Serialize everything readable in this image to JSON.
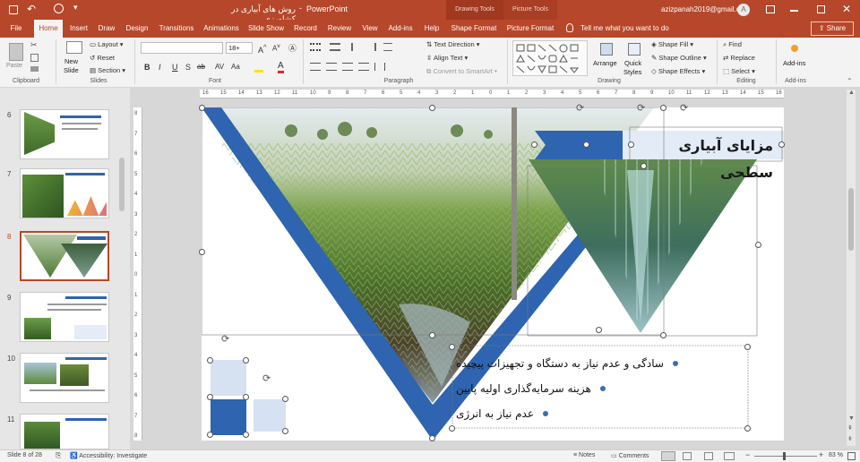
{
  "window": {
    "doc_title": "روش های آبیاری در کشاورزی",
    "app_name": "PowerPoint",
    "context_drawing": "Drawing Tools",
    "context_picture": "Picture Tools",
    "user_email": "azizpanah2019@gmail.com",
    "avatar_initial": "A"
  },
  "tabs": [
    "File",
    "Home",
    "Insert",
    "Draw",
    "Design",
    "Transitions",
    "Animations",
    "Slide Show",
    "Record",
    "Review",
    "View",
    "Add-ins",
    "Help",
    "Shape Format",
    "Picture Format"
  ],
  "tell_me": "Tell me what you want to do",
  "share_label": "Share",
  "ribbon": {
    "clipboard": {
      "paste": "Paste",
      "label": "Clipboard"
    },
    "slides": {
      "new_slide": "New",
      "new_slide2": "Slide",
      "layout": "Layout",
      "reset": "Reset",
      "section": "Section",
      "label": "Slides"
    },
    "font": {
      "size": "18+",
      "label": "Font",
      "bold": "B",
      "italic": "I",
      "underline": "U",
      "strike": "S",
      "shadow": "ab",
      "spacing": "AV",
      "case": "Aa",
      "color_a": "A"
    },
    "paragraph": {
      "text_direction": "Text Direction",
      "align_text": "Align Text",
      "smartart": "Convert to SmartArt",
      "label": "Paragraph"
    },
    "drawing": {
      "arrange": "Arrange",
      "quick": "Quick",
      "styles": "Styles",
      "shape_fill": "Shape Fill",
      "shape_outline": "Shape Outline",
      "shape_effects": "Shape Effects",
      "label": "Drawing"
    },
    "editing": {
      "find": "Find",
      "replace": "Replace",
      "select": "Select",
      "label": "Editing"
    },
    "addins": {
      "addins": "Add-ins",
      "label": "Add-ins"
    }
  },
  "ruler": {
    "h_ticks": [
      "16",
      "15",
      "14",
      "13",
      "12",
      "11",
      "10",
      "9",
      "8",
      "7",
      "6",
      "5",
      "4",
      "3",
      "2",
      "1",
      "0",
      "1",
      "2",
      "3",
      "4",
      "5",
      "6",
      "7",
      "8",
      "9",
      "10",
      "11",
      "12",
      "13",
      "14",
      "15",
      "16"
    ],
    "v_ticks": [
      "8",
      "7",
      "6",
      "5",
      "4",
      "3",
      "2",
      "1",
      "0",
      "1",
      "2",
      "3",
      "4",
      "5",
      "6",
      "7",
      "8"
    ]
  },
  "thumbnails": [
    {
      "num": "6"
    },
    {
      "num": "7"
    },
    {
      "num": "8"
    },
    {
      "num": "9"
    },
    {
      "num": "10"
    },
    {
      "num": "11"
    }
  ],
  "slide": {
    "title": "مزایای آبیاری سطحی",
    "bullets": [
      "سادگی و عدم نیاز به دستگاه و تجهیزات پیچیده",
      "هزینه سرمایه‌گذاری اولیه پایین",
      "عدم نیاز به انرژی"
    ],
    "accent_color": "#2e64b0",
    "light_color": "#d6e2f2"
  },
  "status": {
    "slide_of": "Slide 8 of 28",
    "accessibility": "Accessibility: Investigate",
    "notes": "Notes",
    "comments": "Comments",
    "zoom": "83 %"
  }
}
